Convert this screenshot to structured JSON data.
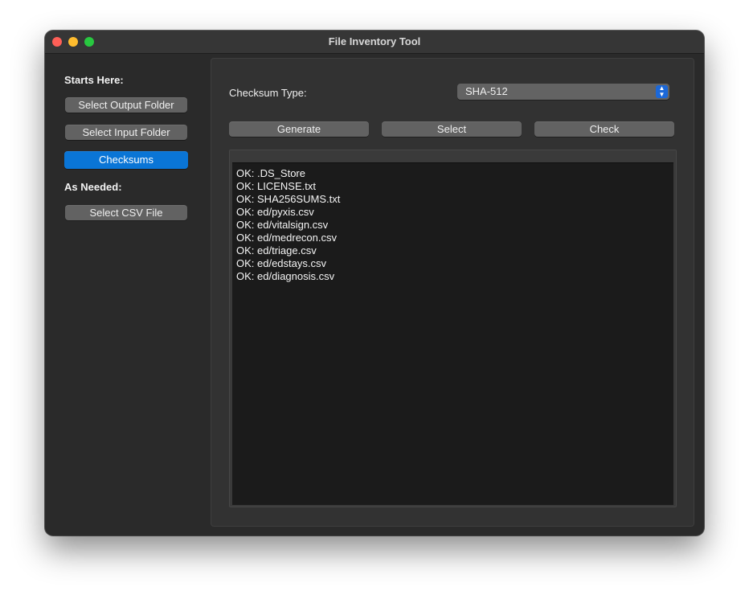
{
  "window": {
    "title": "File Inventory Tool",
    "buttons": [
      "close",
      "minimize",
      "zoom"
    ]
  },
  "sidebar": {
    "starts_here_label": "Starts Here:",
    "select_output_label": "Select Output Folder",
    "select_input_label": "Select Input Folder",
    "checksums_label": "Checksums",
    "as_needed_label": "As Needed:",
    "select_csv_label": "Select CSV File"
  },
  "main": {
    "checksum_type_label": "Checksum Type:",
    "checksum_type_value": "SHA-512",
    "generate_label": "Generate",
    "select_label": "Select",
    "check_label": "Check",
    "output_lines": [
      "OK: .DS_Store",
      "OK: LICENSE.txt",
      "OK: SHA256SUMS.txt",
      "OK: ed/pyxis.csv",
      "OK: ed/vitalsign.csv",
      "OK: ed/medrecon.csv",
      "OK: ed/triage.csv",
      "OK: ed/edstays.csv",
      "OK: ed/diagnosis.csv"
    ]
  },
  "colors": {
    "accent": "#0a75d6",
    "window_bg": "#2a2a2a",
    "panel_bg": "#323232",
    "button_bg": "#626262",
    "output_bg": "#1b1b1b"
  },
  "icons": {
    "close": "close-icon",
    "minimize": "minimize-icon",
    "zoom": "zoom-icon",
    "select_arrows": "up-down-chevron-icon"
  }
}
